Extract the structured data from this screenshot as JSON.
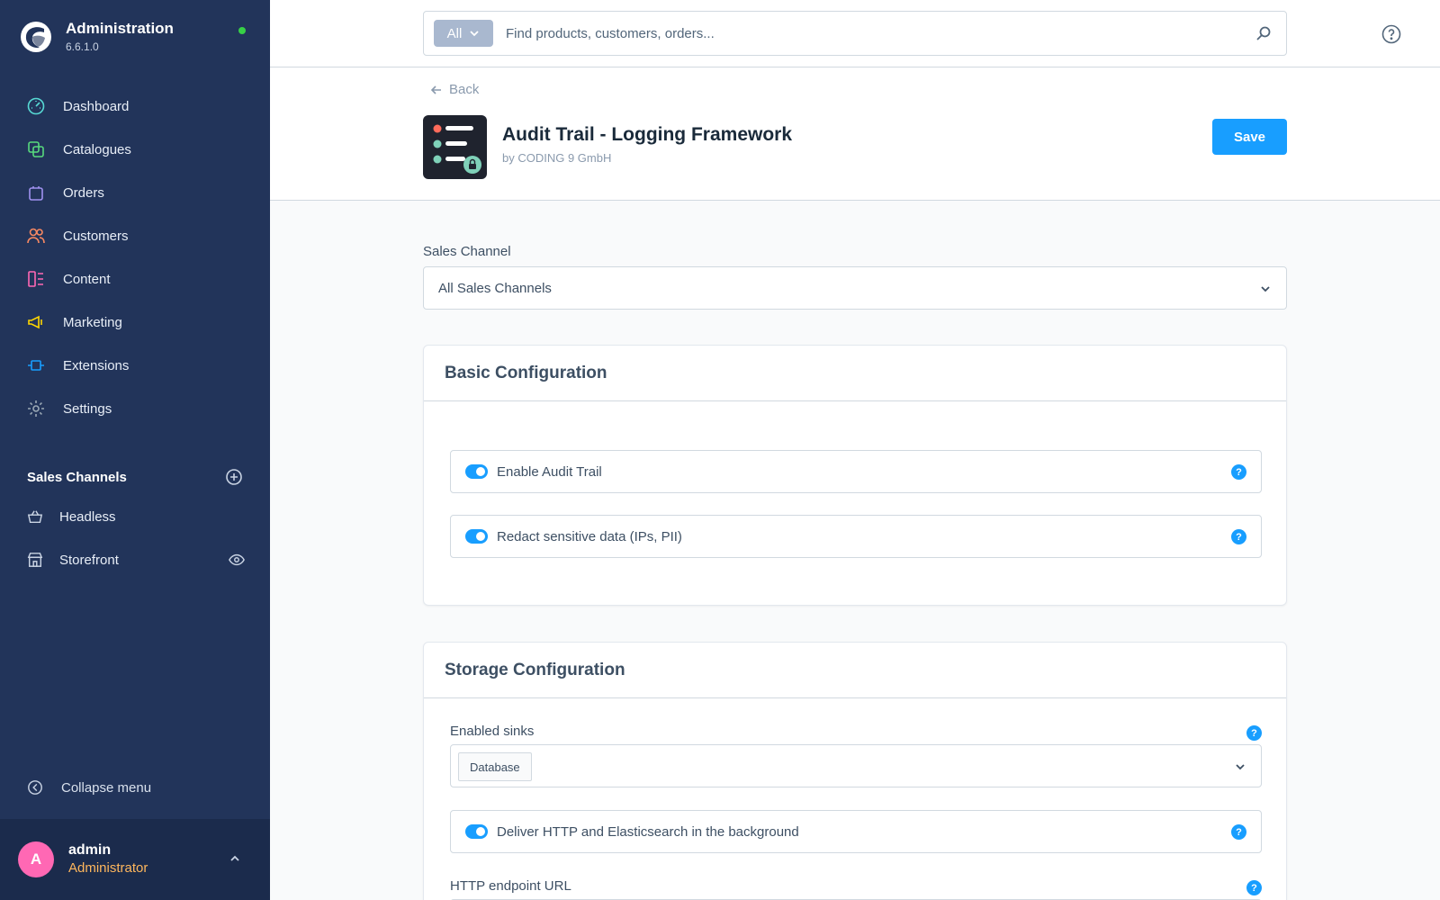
{
  "app": {
    "title": "Administration",
    "version": "6.6.1.0",
    "status_color": "#37d046"
  },
  "sidebar": {
    "items": [
      {
        "label": "Dashboard",
        "icon": "dashboard-gauge-icon",
        "color": "#57d9d4"
      },
      {
        "label": "Catalogues",
        "icon": "catalogue-icon",
        "color": "#57d97d"
      },
      {
        "label": "Orders",
        "icon": "shopping-bag-icon",
        "color": "#a092f0"
      },
      {
        "label": "Customers",
        "icon": "users-icon",
        "color": "#f88962"
      },
      {
        "label": "Content",
        "icon": "content-layout-icon",
        "color": "#ff68b4"
      },
      {
        "label": "Marketing",
        "icon": "megaphone-icon",
        "color": "#ffd700"
      },
      {
        "label": "Extensions",
        "icon": "plug-icon",
        "color": "#189eff"
      },
      {
        "label": "Settings",
        "icon": "gear-icon",
        "color": "#9aa8b5"
      }
    ],
    "sales_channels": {
      "title": "Sales Channels",
      "items": [
        {
          "label": "Headless",
          "icon": "basket-icon"
        },
        {
          "label": "Storefront",
          "icon": "storefront-icon"
        }
      ]
    },
    "collapse_label": "Collapse menu",
    "user": {
      "initial": "A",
      "name": "admin",
      "role": "Administrator"
    }
  },
  "search": {
    "type_label": "All",
    "placeholder": "Find products, customers, orders..."
  },
  "header": {
    "back_label": "Back",
    "plugin_title": "Audit Trail - Logging Framework",
    "plugin_vendor": "by CODING 9 GmbH",
    "save_label": "Save"
  },
  "main": {
    "sales_channel_label": "Sales Channel",
    "sales_channel_value": "All Sales Channels",
    "basic": {
      "title": "Basic Configuration",
      "toggles": [
        {
          "label": "Enable Audit Trail",
          "enabled": true
        },
        {
          "label": "Redact sensitive data (IPs, PII)",
          "enabled": true
        }
      ]
    },
    "storage": {
      "title": "Storage Configuration",
      "sinks_label": "Enabled sinks",
      "sinks_selected": [
        "Database"
      ],
      "background_toggle": {
        "label": "Deliver HTTP and Elasticsearch in the background",
        "enabled": true
      },
      "http_label": "HTTP endpoint URL"
    }
  },
  "help_mark": "?",
  "accent_color": "#189eff"
}
